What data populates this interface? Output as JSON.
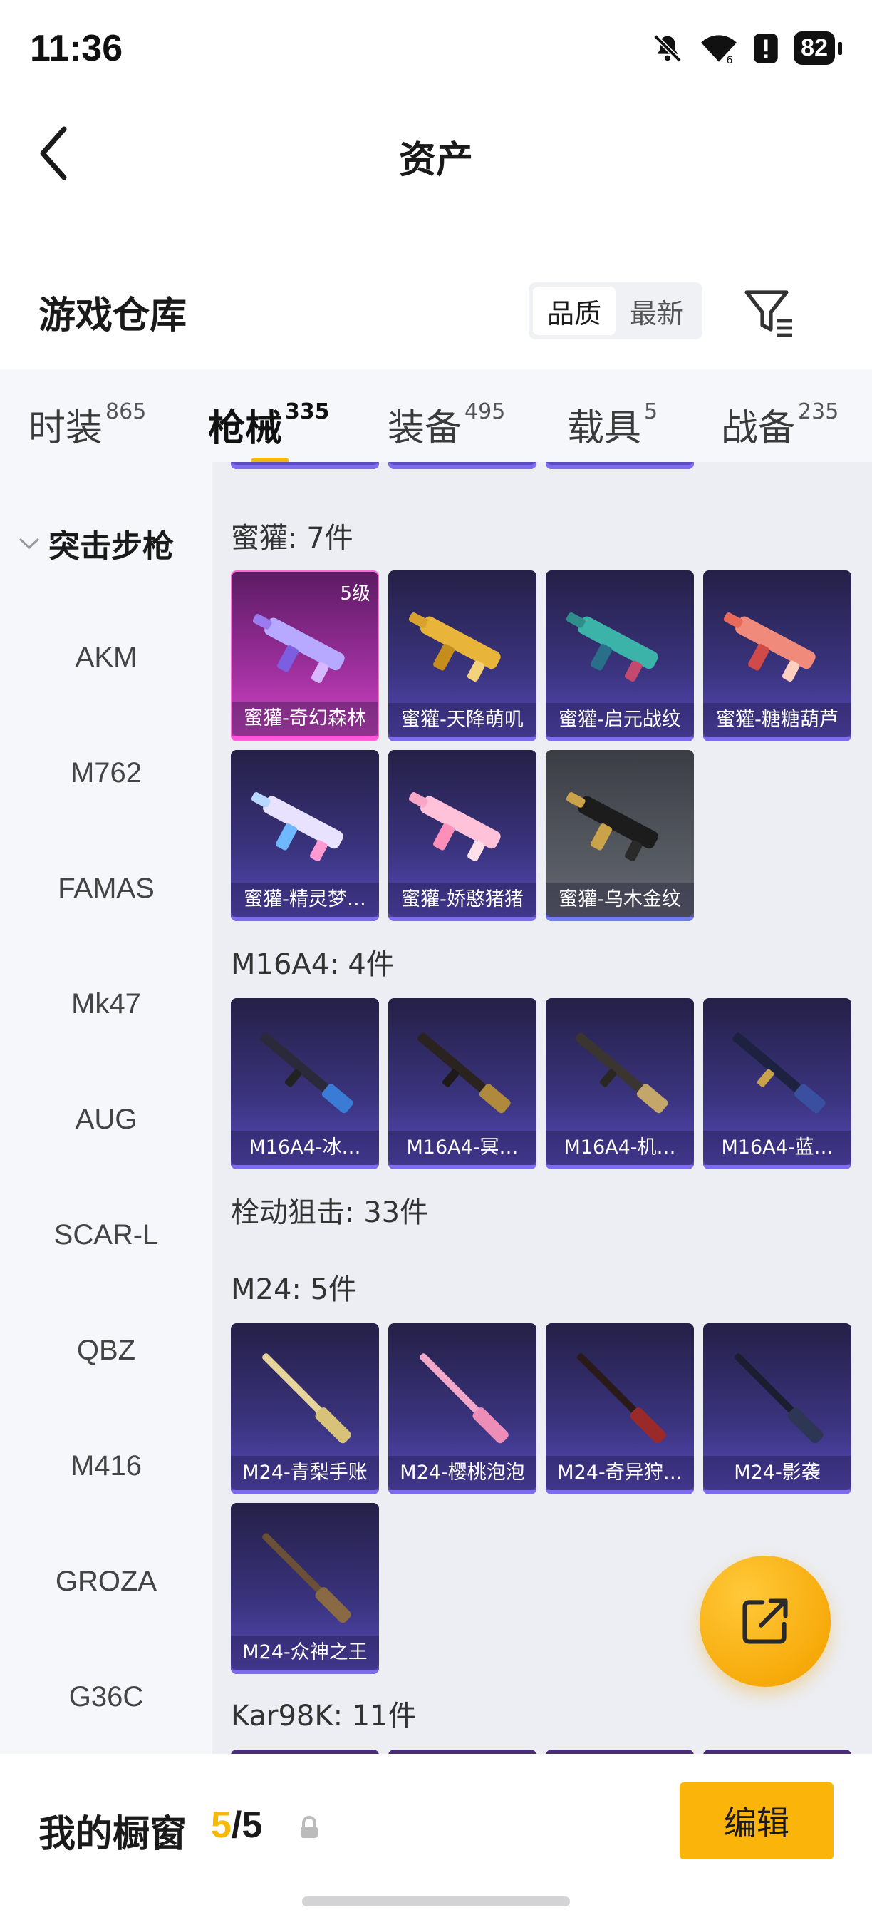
{
  "status_bar": {
    "time": "11:36",
    "battery": "82"
  },
  "header": {
    "title": "资产"
  },
  "warehouse": {
    "title": "游戏仓库",
    "sort_options": [
      "品质",
      "最新"
    ],
    "active_sort": "品质"
  },
  "tabs": [
    {
      "label": "时装",
      "count": "865"
    },
    {
      "label": "枪械",
      "count": "335",
      "active": true
    },
    {
      "label": "装备",
      "count": "495"
    },
    {
      "label": "载具",
      "count": "5"
    },
    {
      "label": "战备",
      "count": "235"
    }
  ],
  "sidebar": {
    "category": "突击步枪",
    "items": [
      "AKM",
      "M762",
      "FAMAS",
      "Mk47",
      "AUG",
      "SCAR-L",
      "QBZ",
      "M416",
      "GROZA",
      "G36C"
    ]
  },
  "groups": {
    "mihuan": {
      "label": "蜜獾: 7件",
      "items": [
        {
          "name": "蜜獾-奇幻森林",
          "level": "5级"
        },
        {
          "name": "蜜獾-天降萌叽"
        },
        {
          "name": "蜜獾-启元战纹"
        },
        {
          "name": "蜜獾-糖糖葫芦"
        },
        {
          "name": "蜜獾-精灵梦…"
        },
        {
          "name": "蜜獾-娇憨猪猪"
        },
        {
          "name": "蜜獾-乌木金纹"
        }
      ]
    },
    "m16a4": {
      "label": "M16A4: 4件",
      "items": [
        {
          "name": "M16A4-冰…"
        },
        {
          "name": "M16A4-冥…"
        },
        {
          "name": "M16A4-机…"
        },
        {
          "name": "M16A4-蓝…"
        }
      ]
    },
    "sniper": {
      "label": "栓动狙击: 33件"
    },
    "m24": {
      "label": "M24: 5件",
      "items": [
        {
          "name": "M24-青梨手账"
        },
        {
          "name": "M24-樱桃泡泡"
        },
        {
          "name": "M24-奇异狩…"
        },
        {
          "name": "M24-影袭"
        },
        {
          "name": "M24-众神之王"
        }
      ]
    },
    "kar98k": {
      "label": "Kar98K: 11件"
    }
  },
  "showcase": {
    "label": "我的橱窗",
    "current": "5",
    "separator": "/",
    "max": "5"
  },
  "edit_button": "编辑",
  "colors": {
    "accent": "#fbb50a",
    "card_purple": "#3b3480",
    "card_pink": "#d445c4"
  }
}
